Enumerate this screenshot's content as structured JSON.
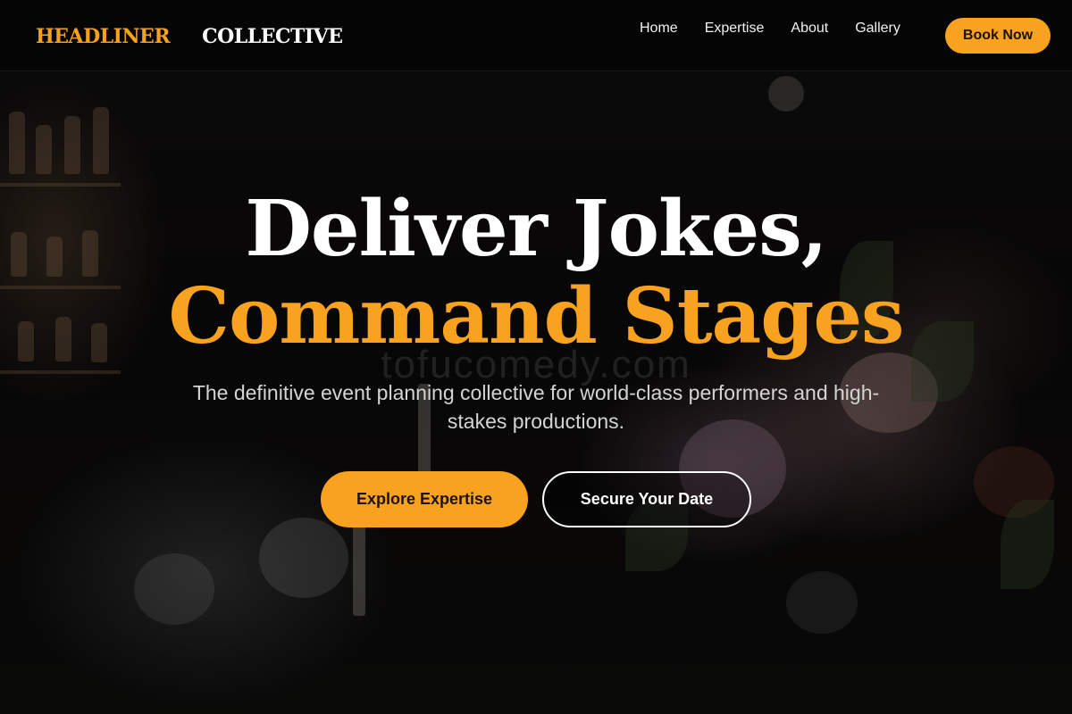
{
  "navbar": {
    "brand_part1": "HEADLINER",
    "brand_part2": "COLLECTIVE",
    "links": [
      "Home",
      "Expertise",
      "About",
      "Gallery"
    ],
    "cta_label": "Book Now"
  },
  "hero": {
    "title_line1": "Deliver Jokes,",
    "title_line2": "Command Stages",
    "watermark": "tofucomedy.com",
    "subtitle": "The definitive event planning collective for world-class performers and high-stakes productions.",
    "primary_cta": "Explore Expertise",
    "secondary_cta": "Secure Your Date"
  },
  "colors": {
    "accent": "#f8a220",
    "background": "#0b0a0a",
    "text": "#ffffff"
  }
}
